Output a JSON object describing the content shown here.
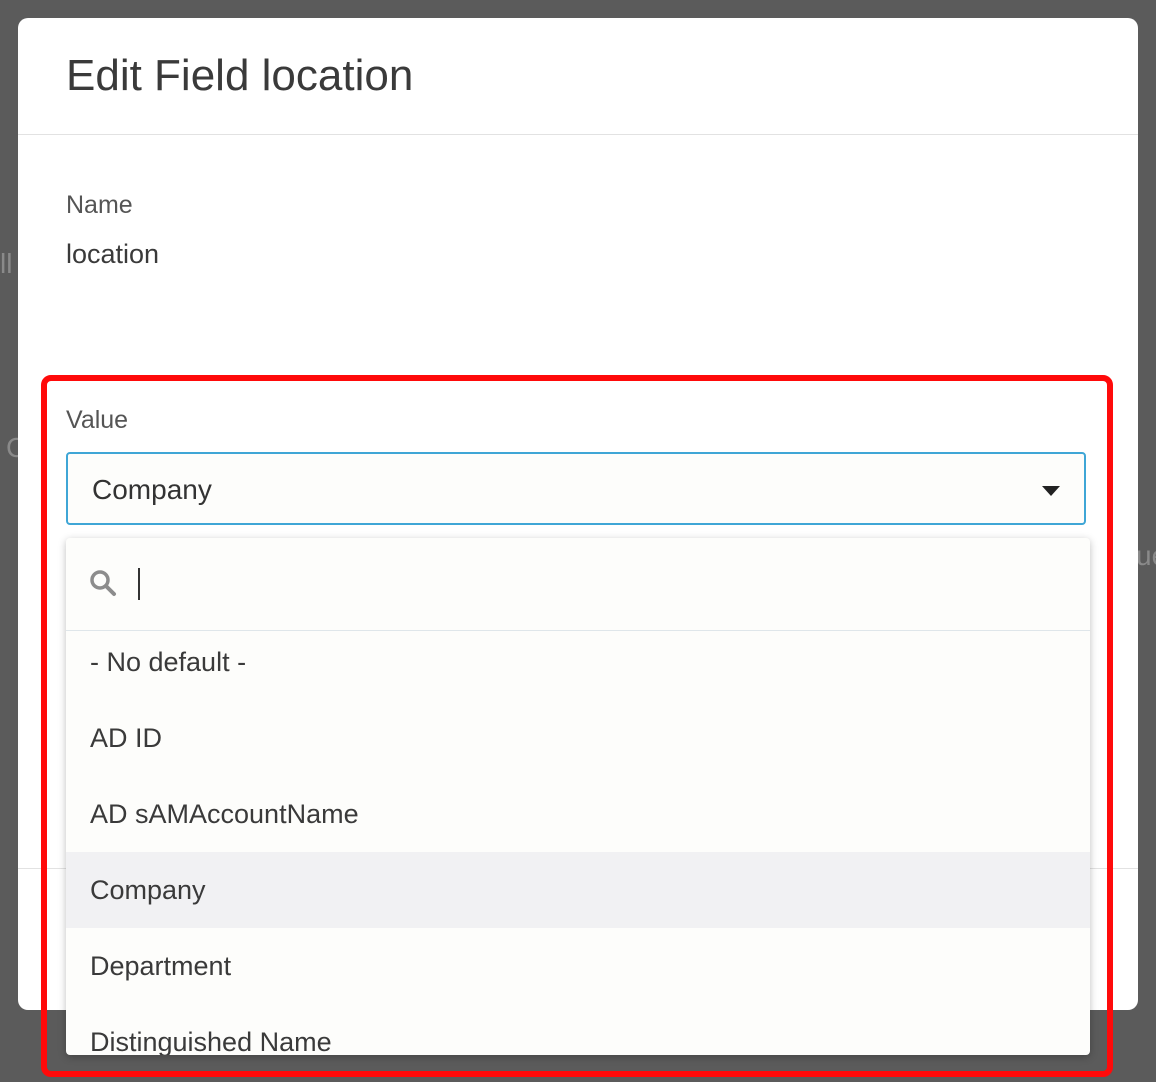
{
  "modal": {
    "title": "Edit Field location"
  },
  "name_field": {
    "label": "Name",
    "value": "location"
  },
  "value_field": {
    "label": "Value",
    "selected": "Company"
  },
  "dropdown": {
    "search_placeholder": "",
    "options": [
      "- No default -",
      "AD ID",
      "AD sAMAccountName",
      "Company",
      "Department",
      "Distinguished Name"
    ],
    "selected_option": "Company"
  },
  "annotation": {
    "frame_color": "#ff0a0a"
  }
}
